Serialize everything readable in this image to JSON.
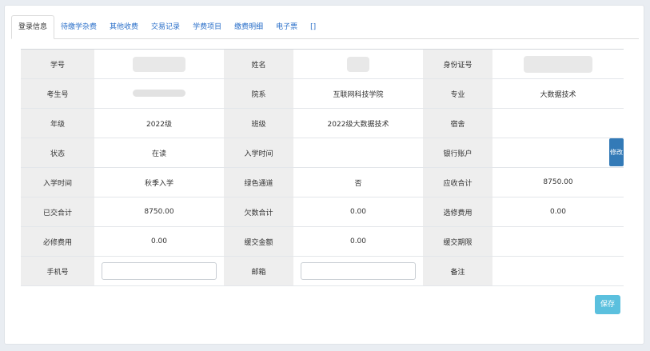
{
  "tabs": [
    {
      "label": "登录信息",
      "active": true
    },
    {
      "label": "待缴学杂费",
      "active": false
    },
    {
      "label": "其他收费",
      "active": false
    },
    {
      "label": "交易记录",
      "active": false
    },
    {
      "label": "学费项目",
      "active": false
    },
    {
      "label": "缴费明细",
      "active": false
    },
    {
      "label": "电子票",
      "active": false
    },
    {
      "label": "[]",
      "active": false
    }
  ],
  "table": {
    "row1": {
      "l1": "学号",
      "v1": "",
      "l2": "姓名",
      "v2": "",
      "l3": "身份证号",
      "v3": ""
    },
    "row2": {
      "l1": "考生号",
      "v1": "",
      "l2": "院系",
      "v2": "互联网科技学院",
      "l3": "专业",
      "v3": "大数据技术"
    },
    "row3": {
      "l1": "年级",
      "v1": "2022级",
      "l2": "班级",
      "v2": "2022级大数据技术",
      "l3": "宿舍",
      "v3": ""
    },
    "row4": {
      "l1": "状态",
      "v1": "在读",
      "l2": "入学时间",
      "v2": "",
      "l3": "银行账户",
      "v3": ""
    },
    "row5": {
      "l1": "入学时间",
      "v1": "秋季入学",
      "l2": "绿色通道",
      "v2": "否",
      "l3": "应收合计",
      "v3": "8750.00"
    },
    "row6": {
      "l1": "已交合计",
      "v1": "8750.00",
      "l2": "欠数合计",
      "v2": "0.00",
      "l3": "选修费用",
      "v3": "0.00"
    },
    "row7": {
      "l1": "必修费用",
      "v1": "0.00",
      "l2": "缓交金额",
      "v2": "0.00",
      "l3": "缓交期限",
      "v3": ""
    },
    "row8": {
      "l1": "手机号",
      "phone_value": "",
      "l2": "邮箱",
      "email_value": "",
      "l3": "备注",
      "v3": ""
    }
  },
  "buttons": {
    "edit": "修改",
    "save": "保存"
  },
  "colors": {
    "accent": "#337ab7",
    "save": "#5bc0de",
    "label_bg": "#eeeeee",
    "link": "#2a6fc9"
  }
}
